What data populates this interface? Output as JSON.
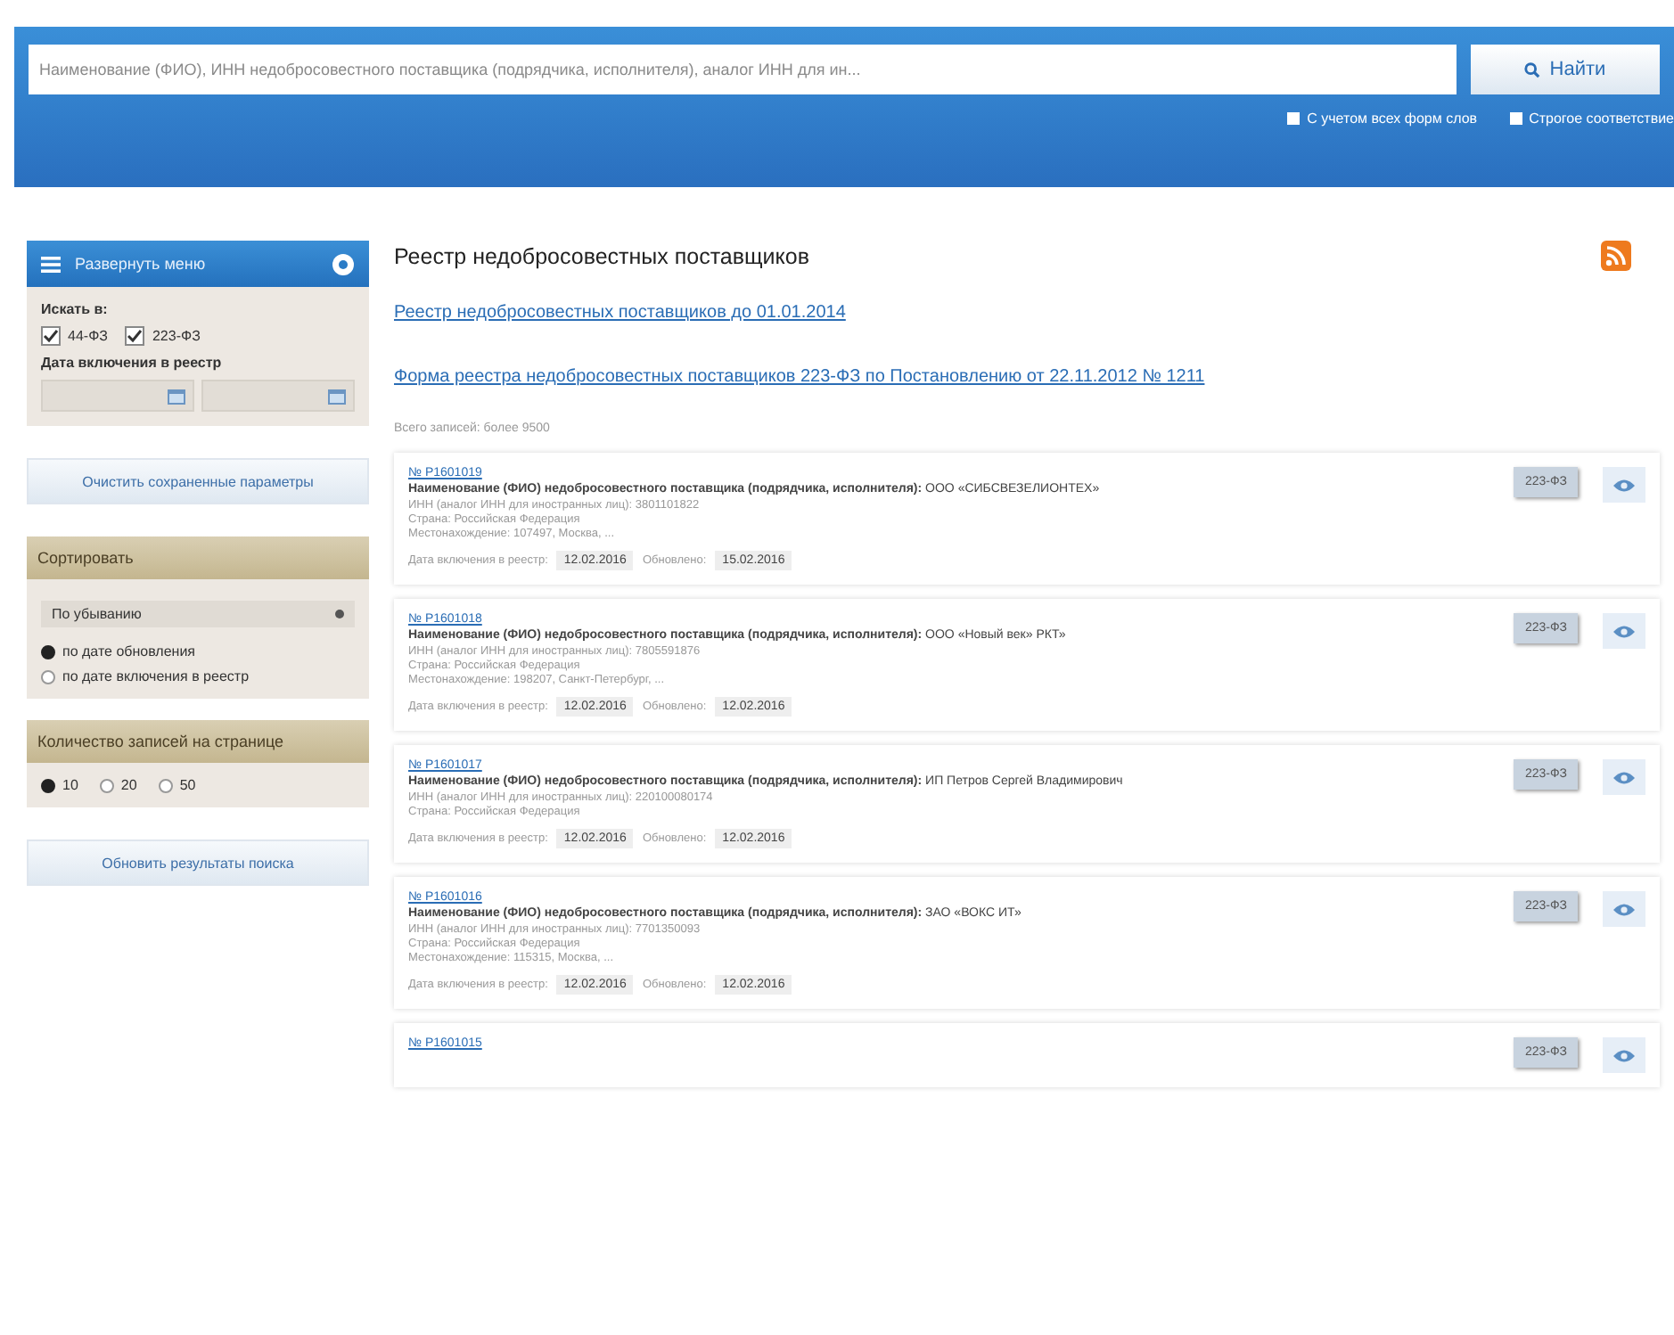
{
  "search": {
    "placeholder": "Наименование (ФИО), ИНН недобросовестного поставщика (подрядчика, исполнителя), аналог ИНН для ин...",
    "button": "Найти",
    "options": [
      {
        "label": "С учетом всех форм слов",
        "checked": false
      },
      {
        "label": "Строгое соответствие",
        "checked": false
      }
    ]
  },
  "sidebar": {
    "menu_button": "Развернуть меню",
    "search_in_label": "Искать в:",
    "laws": [
      {
        "label": "44-ФЗ",
        "checked": true
      },
      {
        "label": "223-ФЗ",
        "checked": true
      }
    ],
    "date_label": "Дата включения в реестр",
    "clear_button": "Очистить сохраненные параметры",
    "sort": {
      "title": "Сортировать",
      "order": "По убыванию",
      "options": [
        {
          "label": "по дате обновления",
          "selected": true
        },
        {
          "label": "по дате включения в реестр",
          "selected": false
        }
      ]
    },
    "page_size": {
      "title": "Количество записей на странице",
      "options": [
        {
          "label": "10",
          "selected": true
        },
        {
          "label": "20",
          "selected": false
        },
        {
          "label": "50",
          "selected": false
        }
      ]
    },
    "refresh_button": "Обновить результаты поиска"
  },
  "main": {
    "title": "Реестр недобросовестных поставщиков",
    "links": [
      "Реестр недобросовестных поставщиков до 01.01.2014",
      "Форма реестра недобросовестных поставщиков 223-ФЗ по Постановлению от 22.11.2012 № 1211"
    ],
    "total": "Всего записей: более 9500",
    "records": [
      {
        "number": "№ Р1601019",
        "name": "**Наименование (ФИО) недобросовестного поставщика (подрядчика, исполнителя):** ООО «СИБСВЕЗЕЛИОНТЕХ»",
        "details": [
          "ИНН (аналог ИНН для иностранных лиц): 3801101822",
          "Страна: Российская Федерация",
          "Местонахождение: 107497, Москва, ..."
        ],
        "included_label": "Дата включения в реестр:",
        "included_date": "12.02.2016",
        "updated_label": "Обновлено:",
        "updated_date": "15.02.2016",
        "law": "223-ФЗ"
      },
      {
        "number": "№ Р1601018",
        "name": "**Наименование (ФИО) недобросовестного поставщика (подрядчика, исполнителя):** ООО «Новый век» РКТ»",
        "details": [
          "ИНН (аналог ИНН для иностранных лиц): 7805591876",
          "Страна: Российская Федерация",
          "Местонахождение: 198207, Санкт-Петербург, ..."
        ],
        "included_label": "Дата включения в реестр:",
        "included_date": "12.02.2016",
        "updated_label": "Обновлено:",
        "updated_date": "12.02.2016",
        "law": "223-ФЗ"
      },
      {
        "number": "№ Р1601017",
        "name": "**Наименование (ФИО) недобросовестного поставщика (подрядчика, исполнителя):** ИП Петров Сергей Владимирович",
        "details": [
          "ИНН (аналог ИНН для иностранных лиц): 220100080174",
          "Страна: Российская Федерация"
        ],
        "included_label": "Дата включения в реестр:",
        "included_date": "12.02.2016",
        "updated_label": "Обновлено:",
        "updated_date": "12.02.2016",
        "law": "223-ФЗ"
      },
      {
        "number": "№ Р1601016",
        "name": "**Наименование (ФИО) недобросовестного поставщика (подрядчика, исполнителя):** ЗАО «ВОКС ИТ»",
        "details": [
          "ИНН (аналог ИНН для иностранных лиц): 7701350093",
          "Страна: Российская Федерация",
          "Местонахождение: 115315, Москва, ..."
        ],
        "included_label": "Дата включения в реестр:",
        "included_date": "12.02.2016",
        "updated_label": "Обновлено:",
        "updated_date": "12.02.2016",
        "law": "223-ФЗ"
      },
      {
        "number": "№ Р1601015",
        "law": "223-ФЗ"
      }
    ]
  }
}
